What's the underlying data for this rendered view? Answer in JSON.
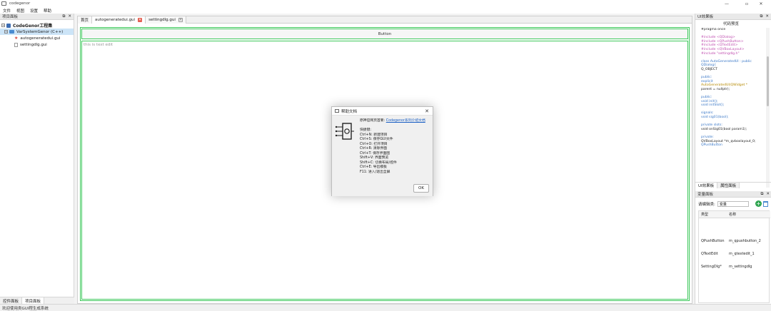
{
  "window": {
    "title": "codegenor",
    "controls": {
      "minimize": "—",
      "maximize": "▫",
      "close": "✕"
    }
  },
  "menubar": {
    "items": [
      "文件",
      "视图",
      "设置",
      "帮助"
    ]
  },
  "left_panel": {
    "title": "项目面板",
    "root_label": "CodeGenor工程集",
    "project_label": "VarSystemGenor (C++)",
    "files": [
      "autogeneratedui.gui",
      "settingdlg.gui"
    ],
    "bottom_tabs": [
      "控件面板",
      "项目面板"
    ]
  },
  "center": {
    "tabs": [
      "首页",
      "autogeneratedui.gui",
      "settingdlg.gui"
    ],
    "button_text": "Button",
    "textedit_placeholder": "this is text edit"
  },
  "dialog": {
    "title": "帮助文档",
    "intro_label": "原神官网页首要:",
    "link_text": "Codegenor系列介绍文档",
    "shortcuts_title": "快捷键:",
    "shortcuts": [
      "Ctrl+N: 新建项目",
      "Ctrl+S: 保存GUI文件",
      "Ctrl+O: 打开项目",
      "Ctrl+R: 清除界面",
      "Ctrl+T: 保存界面图",
      "Shift+V: 界面预览",
      "Shift+C: 切换布局/控件",
      "Ctrl+E: 导出模板",
      "F11: 进入/退出全屏"
    ],
    "ok_label": "OK"
  },
  "right_panel": {
    "title": "UI效果板",
    "code_title": "代码预览",
    "code_lines": [
      {
        "t": "#pragma once",
        "c": "#222"
      },
      {
        "t": "",
        "c": "#222"
      },
      {
        "t": "#include <QDialog>",
        "c": "#c04fb0"
      },
      {
        "t": "#include <QPushButton>",
        "c": "#c04fb0"
      },
      {
        "t": "#include <QTextEdit>",
        "c": "#c04fb0"
      },
      {
        "t": "#include <QVBoxLayout>",
        "c": "#c04fb0"
      },
      {
        "t": "#include \"settingdlg.h\"",
        "c": "#c04fb0"
      },
      {
        "t": "",
        "c": "#222"
      },
      {
        "t": "class AutoGeneratedUI : public",
        "c": "#3b78c7"
      },
      {
        "t": "QDialog{",
        "c": "#3b78c7"
      },
      {
        "t": "  Q_OBJECT",
        "c": "#222"
      },
      {
        "t": "",
        "c": "#222"
      },
      {
        "t": "public:",
        "c": "#3b78c7"
      },
      {
        "t": "  explicit",
        "c": "#3b78c7"
      },
      {
        "t": "  AutoGeneratedUI(QWidget *",
        "c": "#b58900"
      },
      {
        "t": "  parent = nullptr);",
        "c": "#222"
      },
      {
        "t": "",
        "c": "#222"
      },
      {
        "t": "public:",
        "c": "#3b78c7"
      },
      {
        "t": "  void init();",
        "c": "#3b78c7"
      },
      {
        "t": "  void initSlot();",
        "c": "#3b78c7"
      },
      {
        "t": "",
        "c": "#222"
      },
      {
        "t": "signals:",
        "c": "#3b78c7"
      },
      {
        "t": "  void sig01(bool);",
        "c": "#3b78c7"
      },
      {
        "t": "",
        "c": "#222"
      },
      {
        "t": "private slots:",
        "c": "#3b78c7"
      },
      {
        "t": "  void onSig01(bool param1);",
        "c": "#222"
      },
      {
        "t": "",
        "c": "#222"
      },
      {
        "t": "private:",
        "c": "#3b78c7"
      },
      {
        "t": "  QVBoxLayout *m_qvboxlayout_0;",
        "c": "#222"
      },
      {
        "t": "  QPushButton",
        "c": "#3b78c7"
      }
    ],
    "tabs": [
      "UI效果板",
      "属性面板"
    ],
    "var_panel_title": "变量面板",
    "filter_label": "请编辑类:",
    "filter_value": "变量",
    "table_headers": [
      "类型",
      "名称"
    ],
    "rows": [
      [
        "QPushButton",
        "m_qpushbutton_2"
      ],
      [
        "QTextEdit",
        "m_qtextedit_1"
      ],
      [
        "SettingDlg*",
        "m_settingdlg"
      ]
    ]
  },
  "statusbar": {
    "text": "欢迎使用类GUI程生成系统"
  }
}
